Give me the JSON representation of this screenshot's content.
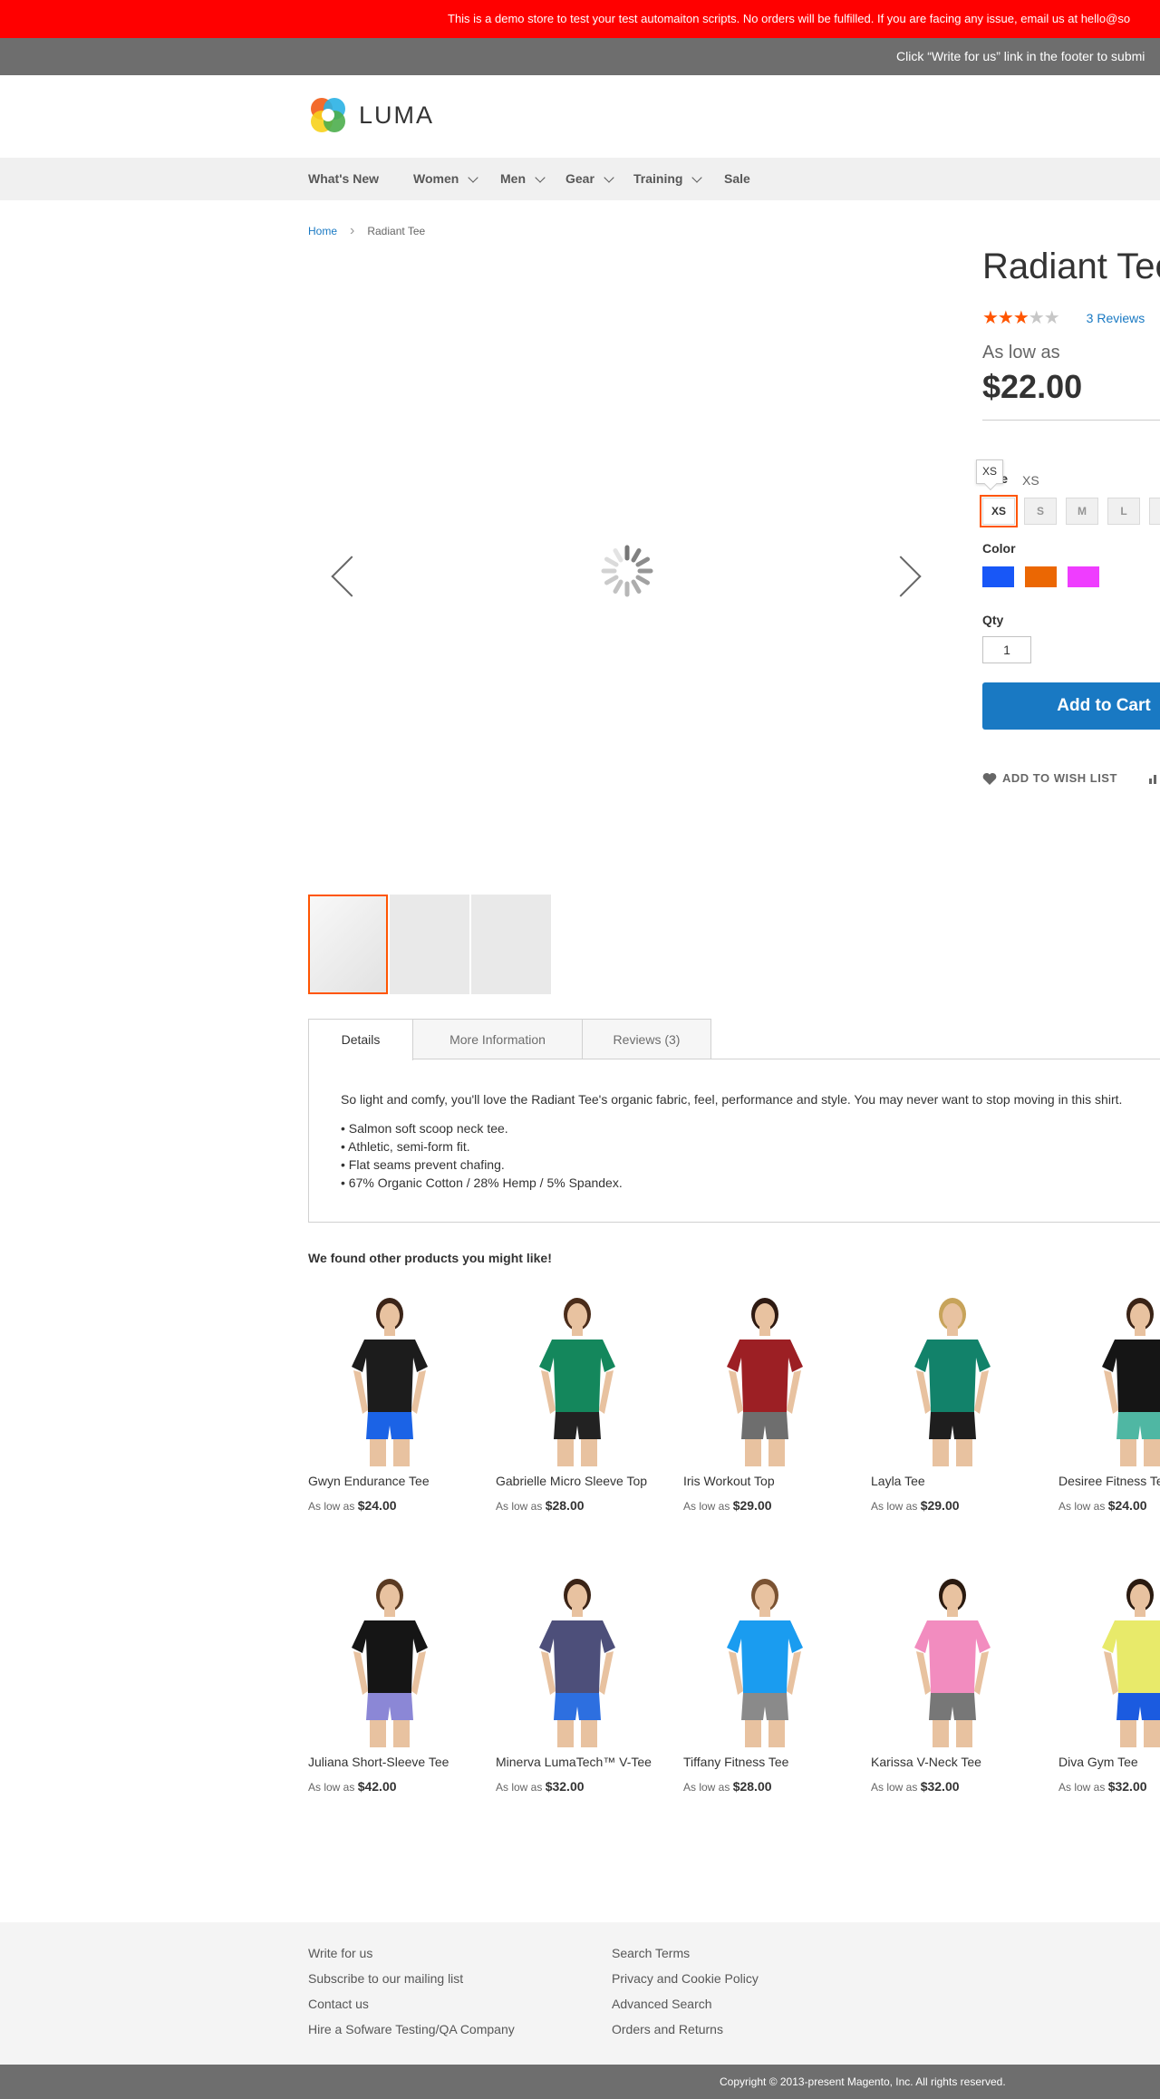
{
  "demo_notice": "This is a demo store to test your test automaiton scripts. No orders will be fulfilled. If you are facing any issue, email us at hello@so",
  "write_notice": "Click “Write for us” link in the footer to submi",
  "logo": {
    "text": "LUMA"
  },
  "nav": {
    "items": [
      {
        "label": "What's New"
      },
      {
        "label": "Women"
      },
      {
        "label": "Men"
      },
      {
        "label": "Gear"
      },
      {
        "label": "Training"
      },
      {
        "label": "Sale"
      }
    ]
  },
  "breadcrumb": {
    "home": "Home",
    "separator": "›",
    "current": "Radiant Tee"
  },
  "product": {
    "title": "Radiant Tee",
    "rating": {
      "stars": 3,
      "out_of": 5,
      "reviews_label": "3  Reviews"
    },
    "as_low_as": "As low as",
    "price": "$22.00",
    "size": {
      "tooltip": "XS",
      "label": "Size",
      "selected": "XS",
      "options": [
        "XS",
        "S",
        "M",
        "L"
      ]
    },
    "color": {
      "label": "Color",
      "swatches": [
        "#1857f7",
        "#eb6703",
        "#ef3dff"
      ]
    },
    "qty": {
      "label": "Qty",
      "value": "1"
    },
    "add_to_cart": "Add to Cart",
    "wishlist": "ADD TO WISH LIST",
    "accent_color": "#ff5501",
    "primary_color": "#1979c3"
  },
  "tabs": {
    "items": [
      {
        "label": "Details"
      },
      {
        "label": "More Information"
      },
      {
        "label": "Reviews (3)"
      }
    ],
    "details": {
      "paragraph": "So light and comfy, you'll love the Radiant Tee's organic fabric, feel, performance and style. You may never want to stop moving in this shirt.",
      "bullets": [
        "• Salmon soft scoop neck tee.",
        "• Athletic, semi-form fit.",
        "• Flat seams prevent chafing.",
        "• 67% Organic Cotton / 28% Hemp / 5% Spandex."
      ]
    }
  },
  "related": {
    "title": "We found other products you might like!",
    "price_prefix": "As low as",
    "products": [
      {
        "name": "Gwyn Endurance Tee",
        "price": "$24.00",
        "shirt": "#1c1c1c",
        "shorts": "#1b63e6",
        "hair": "#3b2418"
      },
      {
        "name": "Gabrielle Micro Sleeve Top",
        "price": "$28.00",
        "shirt": "#14875c",
        "shorts": "#222222",
        "hair": "#4a2c1a"
      },
      {
        "name": "Iris Workout Top",
        "price": "$29.00",
        "shirt": "#9c1f24",
        "shorts": "#6e6e6e",
        "hair": "#2e1a12"
      },
      {
        "name": "Layla Tee",
        "price": "$29.00",
        "shirt": "#12826a",
        "shorts": "#1e1e1e",
        "hair": "#c7a35a"
      },
      {
        "name": "Desiree Fitness Tee",
        "price": "$24.00",
        "shirt": "#151515",
        "shorts": "#4fb7a3",
        "hair": "#3a2316"
      },
      {
        "name": "Juliana Short-Sleeve Tee",
        "price": "$42.00",
        "shirt": "#151515",
        "shorts": "#8b87d6",
        "hair": "#5a3a22"
      },
      {
        "name": "Minerva LumaTech™ V-Tee",
        "price": "$32.00",
        "shirt": "#4d4f7a",
        "shorts": "#2d6fe0",
        "hair": "#3a2316"
      },
      {
        "name": "Tiffany Fitness Tee",
        "price": "$28.00",
        "shirt": "#1a9cf0",
        "shorts": "#8a8a8a",
        "hair": "#7a5232"
      },
      {
        "name": "Karissa V-Neck Tee",
        "price": "$32.00",
        "shirt": "#f28cbf",
        "shorts": "#777777",
        "hair": "#2a1a10"
      },
      {
        "name": "Diva Gym Tee",
        "price": "$32.00",
        "shirt": "#e8ea6a",
        "shorts": "#1b5be0",
        "hair": "#2a1a10"
      }
    ]
  },
  "footer": {
    "col1": [
      "Write for us",
      "Subscribe to our mailing list",
      "Contact us",
      "Hire a Sofware Testing/QA Company"
    ],
    "col2": [
      "Search Terms",
      "Privacy and Cookie Policy",
      "Advanced Search",
      "Orders and Returns"
    ],
    "copyright": "Copyright © 2013-present Magento, Inc. All rights reserved."
  }
}
